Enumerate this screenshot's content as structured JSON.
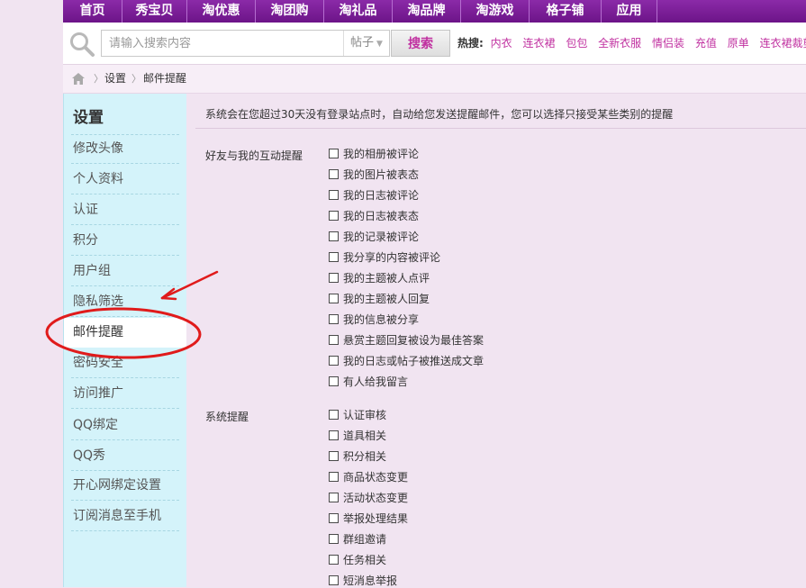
{
  "topnav": {
    "items": [
      {
        "label": "首页"
      },
      {
        "label": "秀宝贝"
      },
      {
        "label": "淘优惠"
      },
      {
        "label": "淘团购"
      },
      {
        "label": "淘礼品"
      },
      {
        "label": "淘品牌"
      },
      {
        "label": "淘游戏"
      },
      {
        "label": "格子铺"
      },
      {
        "label": "应用"
      }
    ]
  },
  "search": {
    "placeholder": "请输入搜索内容",
    "type_selected": "帖子",
    "button_label": "搜索",
    "hot_label": "热搜:",
    "hot_items": [
      "内衣",
      "连衣裙",
      "包包",
      "全新衣服",
      "情侣装",
      "充值",
      "原单",
      "连衣裙裁剪图"
    ]
  },
  "breadcrumb": {
    "items": [
      "设置",
      "邮件提醒"
    ]
  },
  "sidebar": {
    "title": "设置",
    "items": [
      "修改头像",
      "个人资料",
      "认证",
      "积分",
      "用户组",
      "隐私筛选",
      "邮件提醒",
      "密码安全",
      "访问推广",
      "QQ绑定",
      "QQ秀",
      "开心网绑定设置",
      "订阅消息至手机"
    ],
    "active": "邮件提醒"
  },
  "main": {
    "intro": "系统会在您超过30天没有登录站点时，自动给您发送提醒邮件，您可以选择只接受某些类别的提醒",
    "groups": [
      {
        "label": "好友与我的互动提醒",
        "options": [
          "我的相册被评论",
          "我的图片被表态",
          "我的日志被评论",
          "我的日志被表态",
          "我的记录被评论",
          "我分享的内容被评论",
          "我的主题被人点评",
          "我的主题被人回复",
          "我的信息被分享",
          "悬赏主题回复被设为最佳答案",
          "我的日志或帖子被推送成文章",
          "有人给我留言"
        ]
      },
      {
        "label": "系统提醒",
        "options": [
          "认证审核",
          "道具相关",
          "积分相关",
          "商品状态变更",
          "活动状态变更",
          "举报处理结果",
          "群组邀请",
          "任务相关",
          "短消息举报"
        ]
      }
    ]
  },
  "colors": {
    "nav_purple": "#7a1d98",
    "page_bg": "#f1e4f1",
    "sidebar_bg": "#d4f3fa",
    "hot_link": "#c030a0",
    "annotation_red": "#e01b1b"
  }
}
